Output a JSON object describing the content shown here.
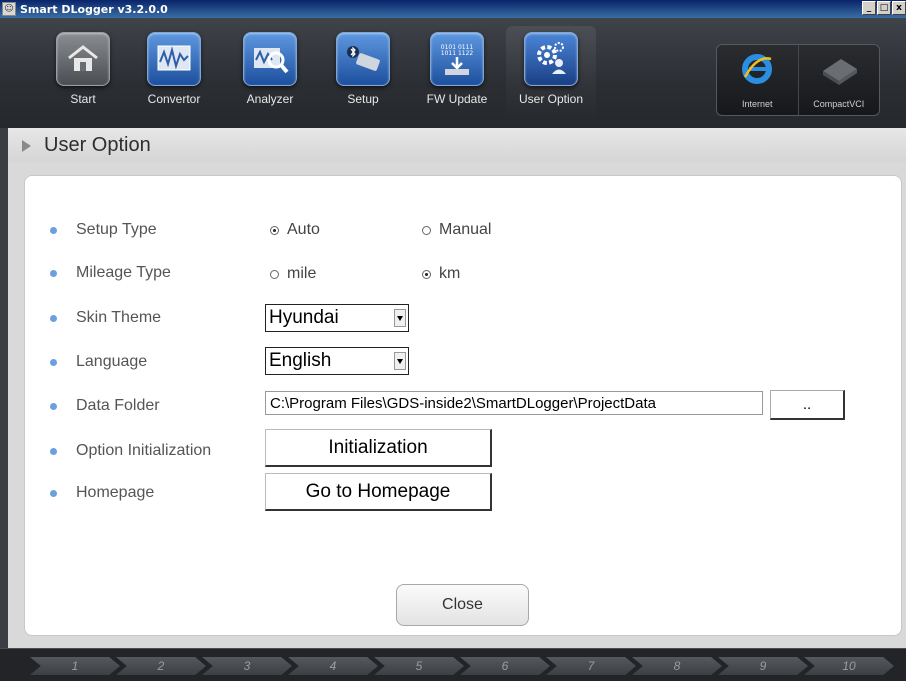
{
  "window": {
    "title": "Smart DLogger v3.2.0.0",
    "buttons": [
      "_",
      "□",
      "x"
    ]
  },
  "toolbar": {
    "tools": [
      {
        "label": "Start",
        "icon": "home-icon"
      },
      {
        "label": "Convertor",
        "icon": "convertor-icon"
      },
      {
        "label": "Analyzer",
        "icon": "analyzer-icon"
      },
      {
        "label": "Setup",
        "icon": "setup-icon"
      },
      {
        "label": "FW Update",
        "icon": "fw-update-icon",
        "chip_text": "0101 0111\n1011 1122"
      },
      {
        "label": "User Option",
        "icon": "gear-user-icon"
      }
    ],
    "external": [
      {
        "label": "Internet",
        "icon": "internet-explorer-icon"
      },
      {
        "label": "CompactVCI",
        "icon": "compact-vci-icon"
      }
    ]
  },
  "section": {
    "title": "User Option"
  },
  "options": {
    "setup_type": {
      "label": "Setup Type",
      "choices": [
        "Auto",
        "Manual"
      ],
      "selected": "Auto"
    },
    "mileage_type": {
      "label": "Mileage Type",
      "choices": [
        "mile",
        "km"
      ],
      "selected": "km"
    },
    "skin_theme": {
      "label": "Skin Theme",
      "value": "Hyundai"
    },
    "language": {
      "label": "Language",
      "value": "English"
    },
    "data_folder": {
      "label": "Data Folder",
      "value": "C:\\Program Files\\GDS-inside2\\SmartDLogger\\ProjectData",
      "browse_label": ".."
    },
    "option_init": {
      "label": "Option Initialization",
      "button": "Initialization"
    },
    "homepage": {
      "label": "Homepage",
      "button": "Go to Homepage"
    }
  },
  "close_label": "Close",
  "steps": [
    "1",
    "2",
    "3",
    "4",
    "5",
    "6",
    "7",
    "8",
    "9",
    "10"
  ]
}
